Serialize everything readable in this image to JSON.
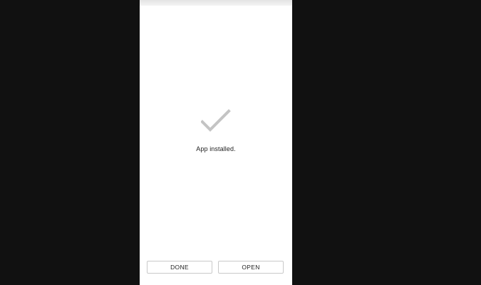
{
  "install_dialog": {
    "status_icon": "checkmark-icon",
    "message": "App installed.",
    "done_label": "DONE",
    "open_label": "OPEN"
  },
  "colors": {
    "background": "#111111",
    "screen": "#ffffff",
    "check": "#c4c4c4",
    "button_border": "#c9c9c9"
  }
}
